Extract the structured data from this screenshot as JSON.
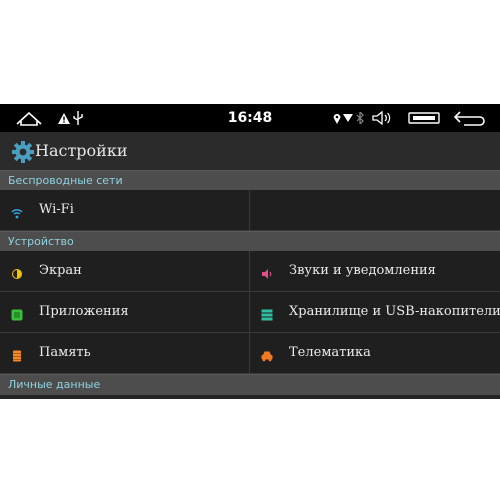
{
  "status_bar": {
    "time": "16:48",
    "icons_left": [
      "home-icon",
      "warning-icon",
      "usb-icon"
    ],
    "icons_right": [
      "location-icon",
      "wifi-signal-icon",
      "bluetooth-icon",
      "volume-icon",
      "recent-apps-icon",
      "back-icon"
    ]
  },
  "header": {
    "title": "Настройки",
    "icon": "gear-icon"
  },
  "sections": {
    "wireless": {
      "label": "Беспроводные сети",
      "items": [
        {
          "label": "Wi-Fi",
          "icon": "wifi-icon",
          "color": "#2fa8e0"
        }
      ]
    },
    "device": {
      "label": "Устройство",
      "items": [
        {
          "label": "Экран",
          "icon": "brightness-icon",
          "color": "#f2c200"
        },
        {
          "label": "Звуки и уведомления",
          "icon": "speaker-icon",
          "color": "#e0508a"
        },
        {
          "label": "Приложения",
          "icon": "apps-icon",
          "color": "#3bbf3b"
        },
        {
          "label": "Хранилище и USB-накопители",
          "icon": "storage-icon",
          "color": "#2fbfa0"
        },
        {
          "label": "Память",
          "icon": "memory-icon",
          "color": "#f08a24"
        },
        {
          "label": "Телематика",
          "icon": "car-icon",
          "color": "#f07a24"
        }
      ]
    },
    "personal": {
      "label": "Личные данные"
    }
  },
  "colors": {
    "background": "#252525",
    "section_bg": "#4d4d4d",
    "section_text": "#8fd3e0",
    "row_bg": "#1f1f1f"
  }
}
